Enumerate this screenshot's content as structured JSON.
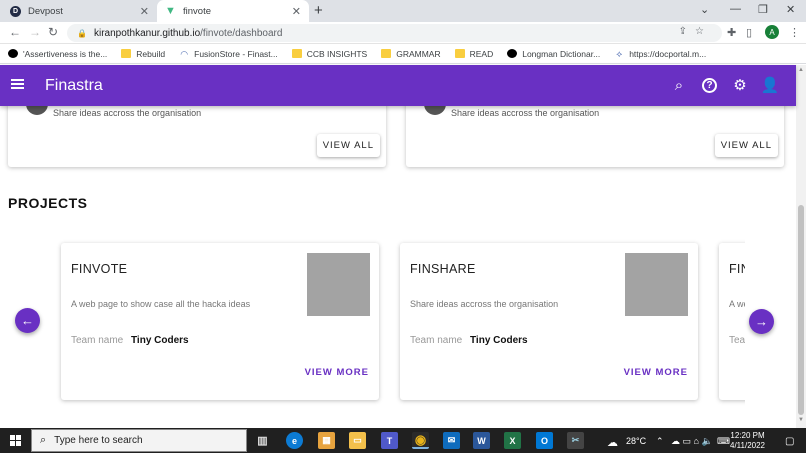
{
  "browser": {
    "tabs": [
      {
        "title": "Devpost",
        "favicon": "D"
      },
      {
        "title": "finvote",
        "favicon": "V"
      }
    ],
    "url_host": "kiranpothkanur.github.io",
    "url_path": "/finvote/dashboard",
    "profile_initial": "A",
    "bookmarks": [
      {
        "label": "'Assertiveness is the...",
        "icon": "dark"
      },
      {
        "label": "Rebuild",
        "icon": "folder"
      },
      {
        "label": "FusionStore - Finast...",
        "icon": "blue"
      },
      {
        "label": "CCB INSIGHTS",
        "icon": "folder"
      },
      {
        "label": "GRAMMAR",
        "icon": "folder"
      },
      {
        "label": "READ",
        "icon": "folder"
      },
      {
        "label": "Longman Dictionar...",
        "icon": "dark"
      },
      {
        "label": "https://docportal.m...",
        "icon": "blue"
      }
    ]
  },
  "app": {
    "title": "Finastra",
    "accent_color": "#6930c3"
  },
  "top_cards": [
    {
      "description": "Share ideas accross the organisation",
      "button": "VIEW ALL"
    },
    {
      "description": "Share ideas accross the organisation",
      "button": "VIEW ALL"
    }
  ],
  "projects": {
    "heading": "PROJECTS",
    "items": [
      {
        "title": "FINVOTE",
        "description": "A web page to show case all the hacka ideas",
        "team_label": "Team name",
        "team_name": "Tiny Coders",
        "button": "VIEW MORE"
      },
      {
        "title": "FINSHARE",
        "description": "Share ideas accross the organisation",
        "team_label": "Team name",
        "team_name": "Tiny Coders",
        "button": "VIEW MORE"
      },
      {
        "title": "FIN",
        "description": "A we",
        "team_label": "Tea",
        "team_name": "",
        "button": ""
      }
    ]
  },
  "taskbar": {
    "search_placeholder": "Type here to search",
    "weather": "28°C",
    "time": "12:20 PM",
    "date": "4/11/2022"
  }
}
